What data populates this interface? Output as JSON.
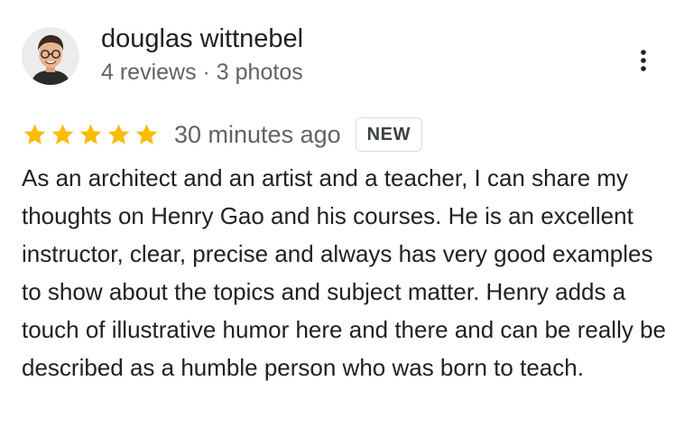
{
  "reviewer": {
    "name": "douglas wittnebel",
    "meta": "4 reviews · 3 photos",
    "avatar_icon": "cartoon-avatar-icon"
  },
  "menu": {
    "icon": "more-vertical-icon"
  },
  "rating": {
    "stars": 5,
    "max": 5,
    "star_color": "#fbbc04",
    "time_ago": "30 minutes ago",
    "badge": "NEW"
  },
  "review": {
    "text": "As an architect and an artist and a teacher, I can share my thoughts on Henry Gao and his courses.  He is an excellent instructor, clear, precise and always has very good examples to show about the topics and subject matter.  Henry adds a touch of illustrative humor here and there and can be really be described as a humble person who was born to teach."
  }
}
